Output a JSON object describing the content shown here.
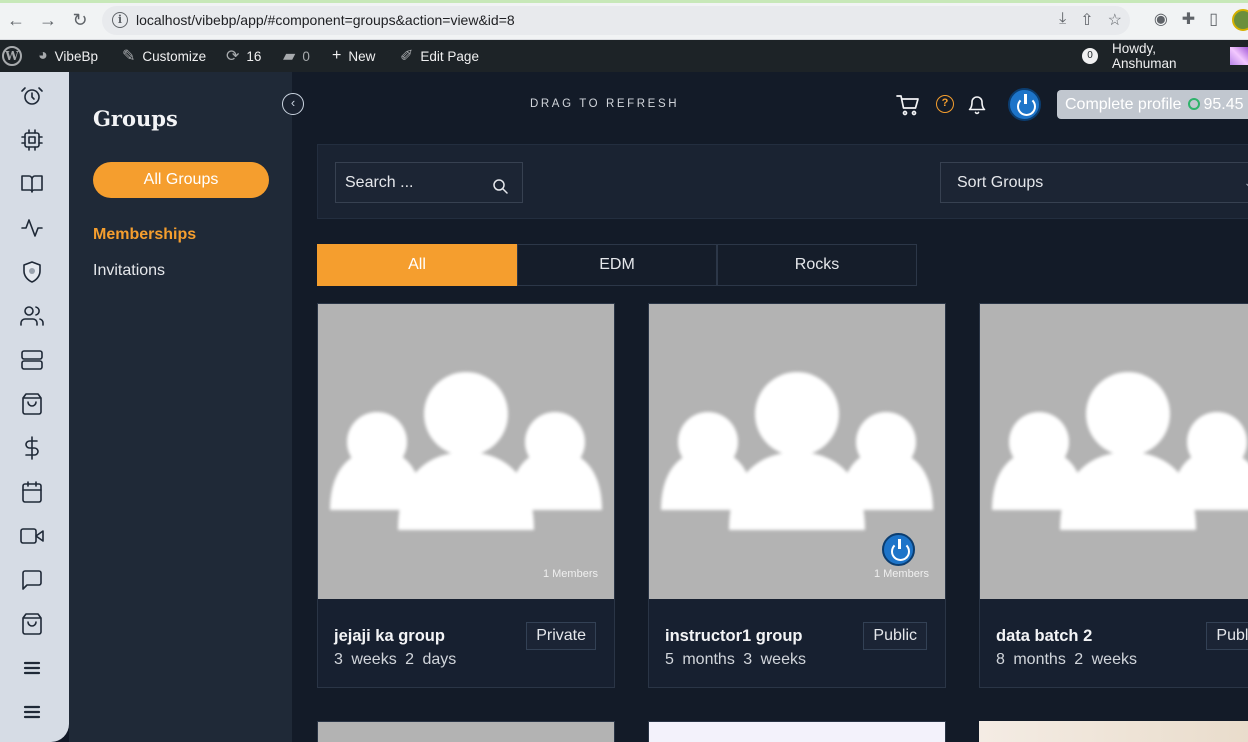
{
  "browser": {
    "url": "localhost/vibebp/app/#component=groups&action=view&id=8"
  },
  "adminbar": {
    "site_name": "VibeBp",
    "customize": "Customize",
    "updates_count": "16",
    "comments_count": "0",
    "new_label": "New",
    "edit_page": "Edit Page",
    "notif_count": "0",
    "howdy": "Howdy, Anshuman"
  },
  "rail": {
    "icons": [
      "alarm-clock-icon",
      "chip-icon",
      "book-icon",
      "activity-icon",
      "badge-icon",
      "users-icon",
      "server-icon",
      "shopping-bag-icon",
      "dollar-icon",
      "calendar-icon",
      "video-icon",
      "message-icon",
      "shopping-bag-icon",
      "menu-icon",
      "menu-icon"
    ]
  },
  "sidebar": {
    "title": "Groups",
    "primary_button": "All Groups",
    "links": [
      {
        "label": "Memberships",
        "active": true
      },
      {
        "label": "Invitations",
        "active": false
      }
    ]
  },
  "header": {
    "drag_label": "DRAG TO REFRESH",
    "complete_profile": "Complete profile",
    "profile_percent": "95.45"
  },
  "toolbar": {
    "search_placeholder": "Search ...",
    "sort_label": "Sort Groups"
  },
  "tabs": [
    {
      "label": "All",
      "active": true
    },
    {
      "label": "EDM",
      "active": false
    },
    {
      "label": "Rocks",
      "active": false
    }
  ],
  "groups": [
    {
      "name": "jejaji ka group",
      "status": "Private",
      "time_a": "3 weeks",
      "time_b": "2 days",
      "members": "1 Members"
    },
    {
      "name": "instructor1 group",
      "status": "Public",
      "time_a": "5 months",
      "time_b": "3 weeks",
      "members": "1 Members"
    },
    {
      "name": "data batch 2",
      "status": "Public",
      "time_a": "8 months",
      "time_b": "2 weeks",
      "members": ""
    }
  ],
  "colors": {
    "accent": "#f59e2e",
    "bg": "#131b28",
    "sidebar": "#1f2937",
    "rail": "#d6dce5"
  }
}
